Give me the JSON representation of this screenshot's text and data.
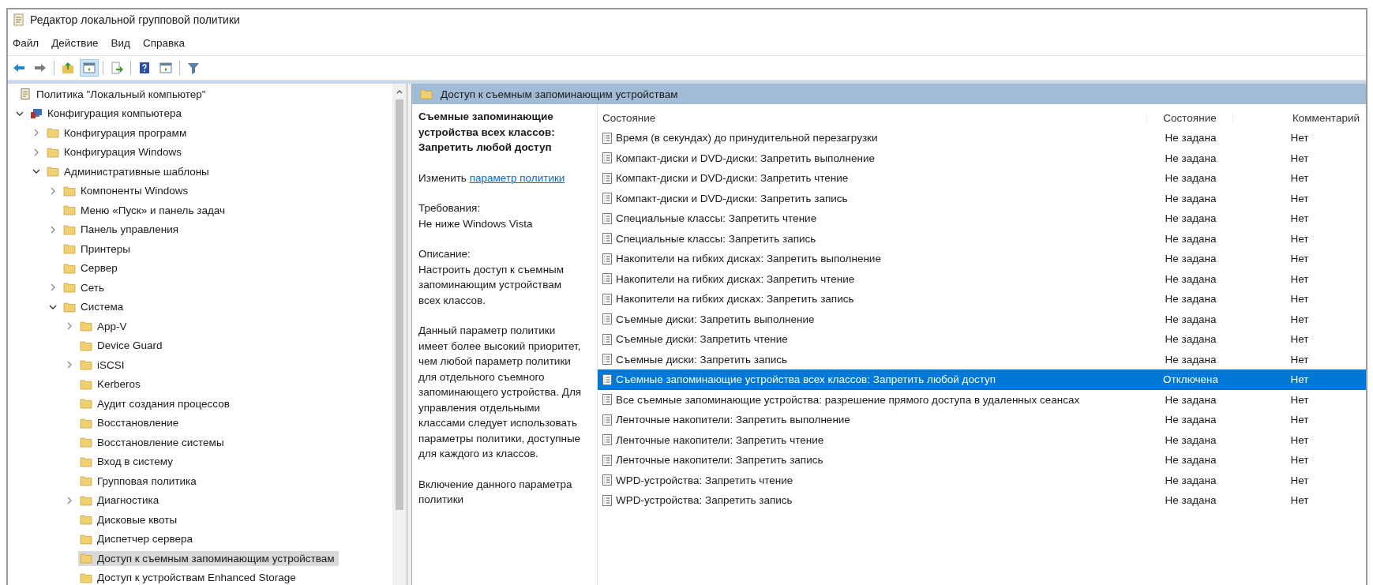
{
  "window": {
    "title": "Редактор локальной групповой политики"
  },
  "menu": [
    "Файл",
    "Действие",
    "Вид",
    "Справка"
  ],
  "toolbar": [
    {
      "kind": "back",
      "pressed": false
    },
    {
      "kind": "forward",
      "pressed": false
    },
    {
      "kind": "sep"
    },
    {
      "kind": "up",
      "pressed": false
    },
    {
      "kind": "tree",
      "pressed": true
    },
    {
      "kind": "sep"
    },
    {
      "kind": "export",
      "pressed": false
    },
    {
      "kind": "sep"
    },
    {
      "kind": "help",
      "pressed": false
    },
    {
      "kind": "pane",
      "pressed": false
    },
    {
      "kind": "sep"
    },
    {
      "kind": "filter",
      "pressed": false
    }
  ],
  "tree": [
    {
      "label": "Политика \"Локальный компьютер\"",
      "kind": "policy",
      "selected": false,
      "children": [
        {
          "label": "Конфигурация компьютера",
          "kind": "computer",
          "expanded": true,
          "selected": false,
          "children": [
            {
              "label": "Конфигурация программ",
              "kind": "folder",
              "expanded": false,
              "selected": false
            },
            {
              "label": "Конфигурация Windows",
              "kind": "folder",
              "expanded": false,
              "selected": false
            },
            {
              "label": "Административные шаблоны",
              "kind": "folder",
              "expanded": true,
              "selected": false,
              "children": [
                {
                  "label": "Компоненты Windows",
                  "kind": "folder",
                  "expanded": false,
                  "selected": false
                },
                {
                  "label": "Меню «Пуск» и панель задач",
                  "kind": "folder",
                  "selected": false
                },
                {
                  "label": "Панель управления",
                  "kind": "folder",
                  "expanded": false,
                  "selected": false
                },
                {
                  "label": "Принтеры",
                  "kind": "folder",
                  "selected": false
                },
                {
                  "label": "Сервер",
                  "kind": "folder",
                  "selected": false
                },
                {
                  "label": "Сеть",
                  "kind": "folder",
                  "expanded": false,
                  "selected": false
                },
                {
                  "label": "Система",
                  "kind": "folder",
                  "expanded": true,
                  "selected": false,
                  "children": [
                    {
                      "label": "App-V",
                      "kind": "folder",
                      "expanded": false,
                      "selected": false
                    },
                    {
                      "label": "Device Guard",
                      "kind": "folder",
                      "selected": false
                    },
                    {
                      "label": "iSCSI",
                      "kind": "folder",
                      "expanded": false,
                      "selected": false
                    },
                    {
                      "label": "Kerberos",
                      "kind": "folder",
                      "selected": false
                    },
                    {
                      "label": "Аудит создания процессов",
                      "kind": "folder",
                      "selected": false
                    },
                    {
                      "label": "Восстановление",
                      "kind": "folder",
                      "selected": false
                    },
                    {
                      "label": "Восстановление системы",
                      "kind": "folder",
                      "selected": false
                    },
                    {
                      "label": "Вход в систему",
                      "kind": "folder",
                      "selected": false
                    },
                    {
                      "label": "Групповая политика",
                      "kind": "folder",
                      "selected": false
                    },
                    {
                      "label": "Диагностика",
                      "kind": "folder",
                      "expanded": false,
                      "selected": false
                    },
                    {
                      "label": "Дисковые квоты",
                      "kind": "folder",
                      "selected": false
                    },
                    {
                      "label": "Диспетчер сервера",
                      "kind": "folder",
                      "selected": false
                    },
                    {
                      "label": "Доступ к съемным запоминающим устройствам",
                      "kind": "folder",
                      "selected": true
                    },
                    {
                      "label": "Доступ к устройствам Enhanced Storage",
                      "kind": "folder",
                      "selected": false
                    }
                  ]
                }
              ]
            }
          ]
        }
      ]
    }
  ],
  "header": "Доступ к съемным запоминающим устройствам",
  "details": {
    "title": "Съемные запоминающие устройства всех классов: Запретить любой доступ",
    "edit_prefix": "Изменить",
    "edit_link": "параметр политики",
    "requirements_label": "Требования:",
    "requirements": "Не ниже Windows Vista",
    "description_label": "Описание:",
    "description": "Настроить доступ к съемным запоминающим устройствам всех классов.",
    "paragraphs": [
      "Данный параметр политики имеет более высокий приоритет, чем любой параметр политики для отдельного съемного запоминающего устройства. Для управления отдельными классами следует использовать параметры политики, доступные для каждого из классов.",
      "Включение данного параметра политики"
    ]
  },
  "table": {
    "columns": [
      "Состояние",
      "Состояние",
      "Комментарий"
    ],
    "rows": [
      {
        "name": "Время (в секундах) до принудительной перезагрузки",
        "state": "Не задана",
        "comment": "Нет",
        "selected": false
      },
      {
        "name": "Компакт-диски и DVD-диски: Запретить выполнение",
        "state": "Не задана",
        "comment": "Нет",
        "selected": false
      },
      {
        "name": "Компакт-диски и DVD-диски: Запретить чтение",
        "state": "Не задана",
        "comment": "Нет",
        "selected": false
      },
      {
        "name": "Компакт-диски и DVD-диски: Запретить запись",
        "state": "Не задана",
        "comment": "Нет",
        "selected": false
      },
      {
        "name": "Специальные классы: Запретить чтение",
        "state": "Не задана",
        "comment": "Нет",
        "selected": false
      },
      {
        "name": "Специальные классы: Запретить запись",
        "state": "Не задана",
        "comment": "Нет",
        "selected": false
      },
      {
        "name": "Накопители на гибких дисках: Запретить выполнение",
        "state": "Не задана",
        "comment": "Нет",
        "selected": false
      },
      {
        "name": "Накопители на гибких дисках: Запретить чтение",
        "state": "Не задана",
        "comment": "Нет",
        "selected": false
      },
      {
        "name": "Накопители на гибких дисках: Запретить запись",
        "state": "Не задана",
        "comment": "Нет",
        "selected": false
      },
      {
        "name": "Съемные диски: Запретить выполнение",
        "state": "Не задана",
        "comment": "Нет",
        "selected": false
      },
      {
        "name": "Съемные диски: Запретить чтение",
        "state": "Не задана",
        "comment": "Нет",
        "selected": false
      },
      {
        "name": "Съемные диски: Запретить запись",
        "state": "Не задана",
        "comment": "Нет",
        "selected": false
      },
      {
        "name": "Съемные запоминающие устройства всех классов: Запретить любой доступ",
        "state": "Отключена",
        "comment": "Нет",
        "selected": true
      },
      {
        "name": "Все съемные запоминающие устройства: разрешение прямого доступа в удаленных сеансах",
        "state": "Не задана",
        "comment": "Нет",
        "selected": false
      },
      {
        "name": "Ленточные накопители: Запретить выполнение",
        "state": "Не задана",
        "comment": "Нет",
        "selected": false
      },
      {
        "name": "Ленточные накопители: Запретить чтение",
        "state": "Не задана",
        "comment": "Нет",
        "selected": false
      },
      {
        "name": "Ленточные накопители: Запретить запись",
        "state": "Не задана",
        "comment": "Нет",
        "selected": false
      },
      {
        "name": "WPD-устройства: Запретить чтение",
        "state": "Не задана",
        "comment": "Нет",
        "selected": false
      },
      {
        "name": "WPD-устройства: Запретить запись",
        "state": "Не задана",
        "comment": "Нет",
        "selected": false
      }
    ]
  }
}
